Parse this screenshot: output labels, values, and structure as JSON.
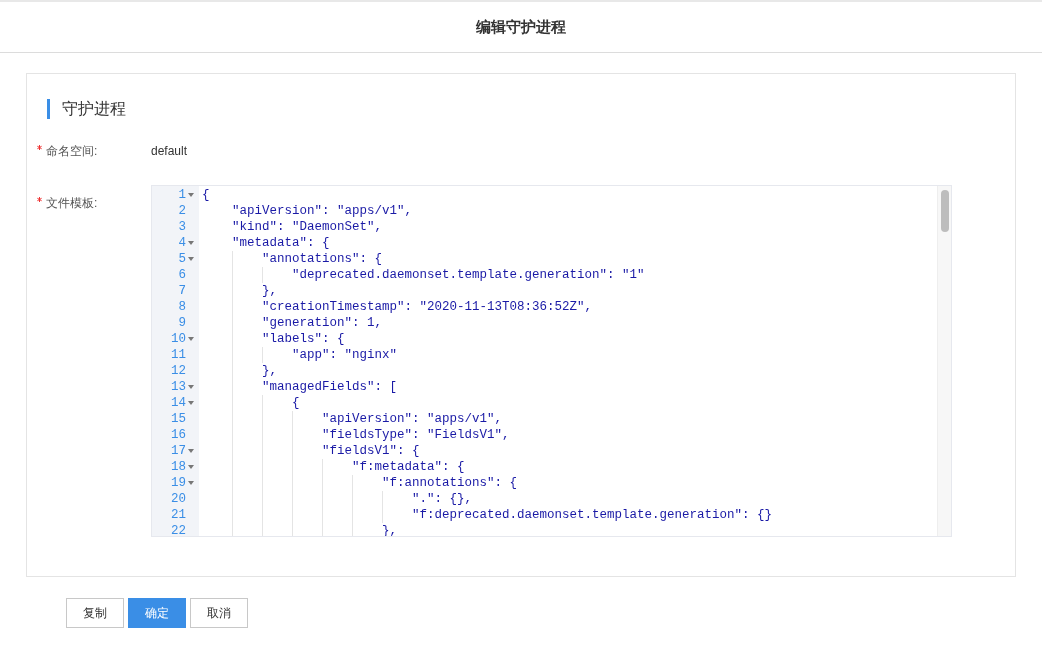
{
  "header": {
    "title": "编辑守护进程"
  },
  "section": {
    "title": "守护进程"
  },
  "fields": [
    {
      "label": "命名空间:",
      "required": true,
      "value": "default"
    },
    {
      "label": "文件模板:",
      "required": true
    }
  ],
  "editor": {
    "lines": [
      {
        "number": "1",
        "text": "{",
        "foldable": true
      },
      {
        "number": "2",
        "text": "    \"apiVersion\": \"apps/v1\",",
        "foldable": false
      },
      {
        "number": "3",
        "text": "    \"kind\": \"DaemonSet\",",
        "foldable": false
      },
      {
        "number": "4",
        "text": "    \"metadata\": {",
        "foldable": true
      },
      {
        "number": "5",
        "text": "        \"annotations\": {",
        "foldable": true
      },
      {
        "number": "6",
        "text": "            \"deprecated.daemonset.template.generation\": \"1\"",
        "foldable": false
      },
      {
        "number": "7",
        "text": "        },",
        "foldable": false
      },
      {
        "number": "8",
        "text": "        \"creationTimestamp\": \"2020-11-13T08:36:52Z\",",
        "foldable": false
      },
      {
        "number": "9",
        "text": "        \"generation\": 1,",
        "foldable": false
      },
      {
        "number": "10",
        "text": "        \"labels\": {",
        "foldable": true
      },
      {
        "number": "11",
        "text": "            \"app\": \"nginx\"",
        "foldable": false
      },
      {
        "number": "12",
        "text": "        },",
        "foldable": false
      },
      {
        "number": "13",
        "text": "        \"managedFields\": [",
        "foldable": true
      },
      {
        "number": "14",
        "text": "            {",
        "foldable": true
      },
      {
        "number": "15",
        "text": "                \"apiVersion\": \"apps/v1\",",
        "foldable": false
      },
      {
        "number": "16",
        "text": "                \"fieldsType\": \"FieldsV1\",",
        "foldable": false
      },
      {
        "number": "17",
        "text": "                \"fieldsV1\": {",
        "foldable": true
      },
      {
        "number": "18",
        "text": "                    \"f:metadata\": {",
        "foldable": true
      },
      {
        "number": "19",
        "text": "                        \"f:annotations\": {",
        "foldable": true
      },
      {
        "number": "20",
        "text": "                            \".\": {},",
        "foldable": false
      },
      {
        "number": "21",
        "text": "                            \"f:deprecated.daemonset.template.generation\": {}",
        "foldable": false
      },
      {
        "number": "22",
        "text": "                        },",
        "foldable": false
      }
    ]
  },
  "buttons": [
    {
      "label": "复制",
      "kind": "default"
    },
    {
      "label": "确定",
      "kind": "primary"
    },
    {
      "label": "取消",
      "kind": "default"
    }
  ]
}
